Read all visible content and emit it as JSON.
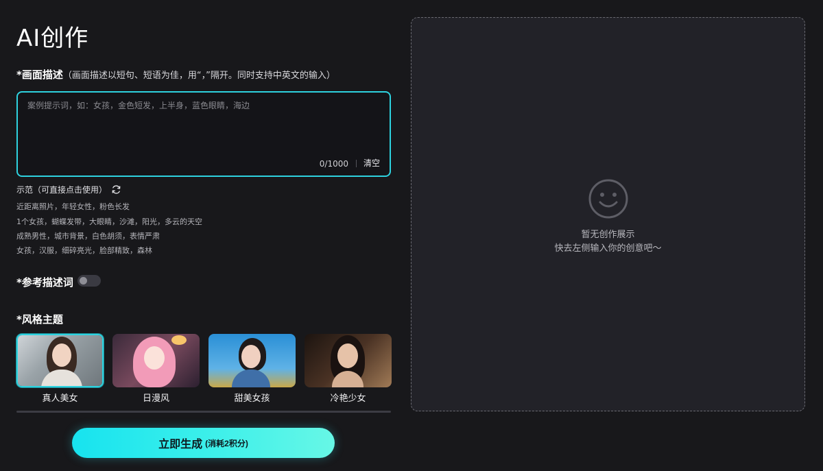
{
  "header": {
    "title": "AI创作"
  },
  "prompt": {
    "label": "*画面描述",
    "hint": "（画面描述以短句、短语为佳，用“，”隔开。同时支持中英文的输入）",
    "placeholder": "案例提示词，如：女孩，金色短发，上半身，蓝色眼睛，海边",
    "value": "",
    "counter": "0/1000",
    "clear_label": "清空"
  },
  "examples": {
    "label": "示范（可直接点击使用）",
    "refresh_icon": "refresh-icon",
    "items": [
      "近距离照片，年轻女性，粉色长发",
      "1个女孩，蝴蝶发带，大眼睛，沙滩，阳光，多云的天空",
      "成熟男性，城市背景，白色胡须，表情严肃",
      "女孩，汉服，细碎亮光，脸部精致，森林"
    ]
  },
  "reference": {
    "label": "*参考描述词",
    "enabled": false
  },
  "styles": {
    "label": "*风格主题",
    "selected_index": 0,
    "items": [
      {
        "name": "真人美女",
        "thumbnail": "realistic-woman-thumbnail"
      },
      {
        "name": "日漫风",
        "thumbnail": "anime-girl-thumbnail"
      },
      {
        "name": "甜美女孩",
        "thumbnail": "sweet-girl-thumbnail"
      },
      {
        "name": "冷艳少女",
        "thumbnail": "cool-girl-thumbnail"
      }
    ]
  },
  "generate": {
    "label": "立即生成",
    "cost": "(消耗2积分)"
  },
  "preview": {
    "icon": "smiley-icon",
    "empty_title": "暂无创作展示",
    "empty_subtitle": "快去左侧输入你的创意吧～"
  },
  "colors": {
    "background": "#18181b",
    "accent": "#2ed3e0",
    "panel": "#222228",
    "button_gradient_start": "#17e3ef",
    "button_gradient_end": "#67f7e6"
  }
}
